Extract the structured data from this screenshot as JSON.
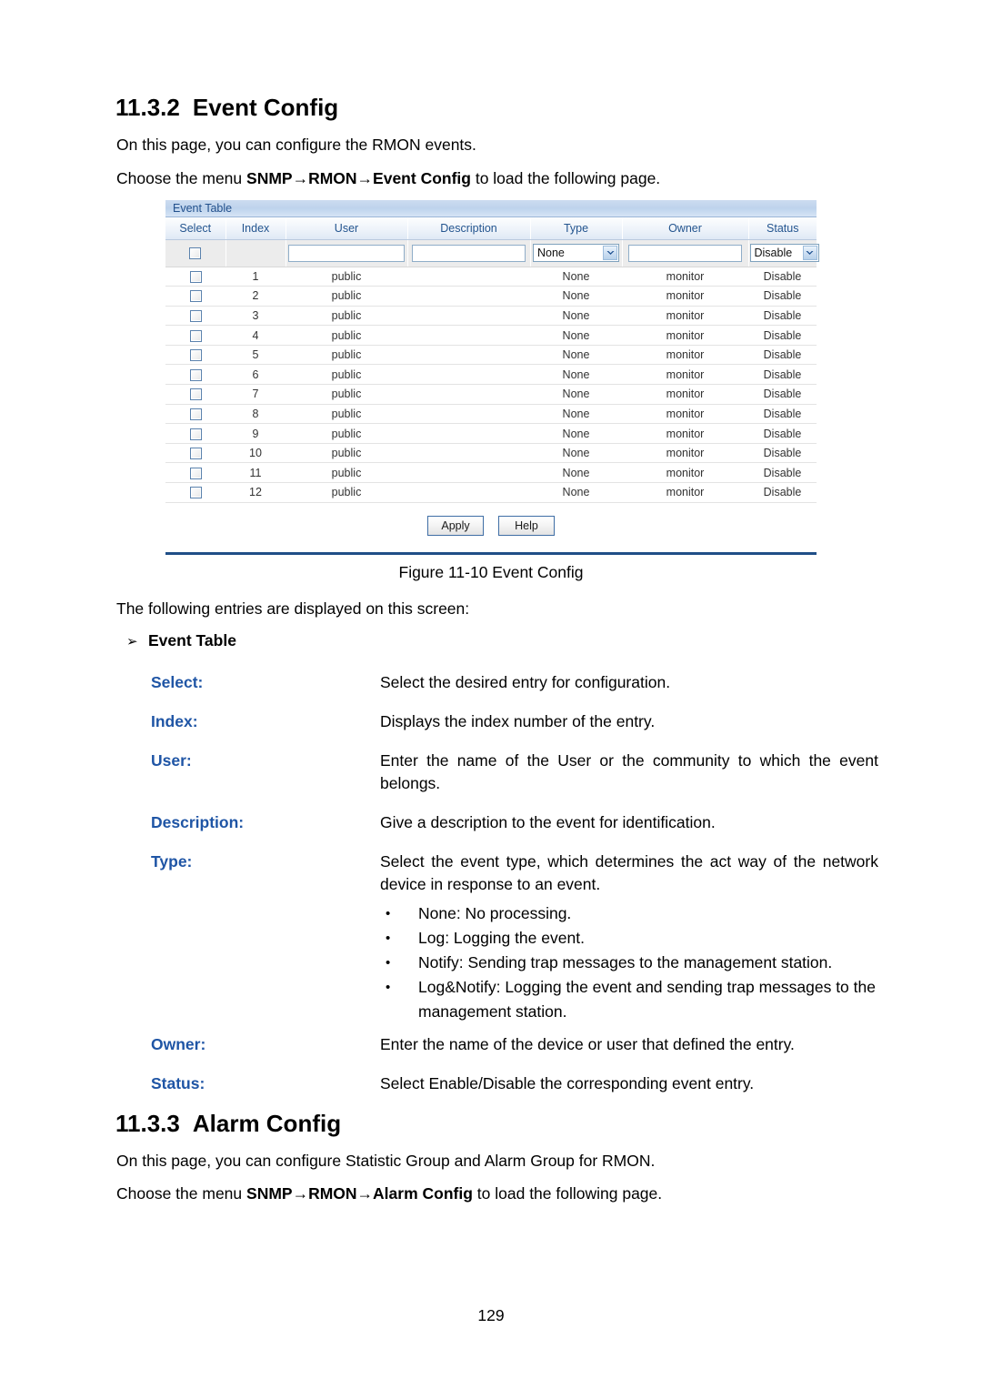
{
  "document": {
    "page_number": "129"
  },
  "section_event": {
    "number": "11.3.2",
    "title": "Event Config",
    "intro": "On this page, you can configure the RMON events.",
    "menu_prefix": "Choose the menu ",
    "menu_path_1": "SNMP",
    "menu_arrow": "→",
    "menu_path_2": "RMON",
    "menu_path_3": "Event Config",
    "menu_suffix": " to load the following page.",
    "figure_caption": "Figure 11-10 Event Config",
    "entries_intro": "The following entries are displayed on this screen:",
    "arrow_glyph": "➢",
    "group_title": "Event Table"
  },
  "event_table": {
    "panel_title": "Event Table",
    "columns": [
      "Select",
      "Index",
      "User",
      "Description",
      "Type",
      "Owner",
      "Status"
    ],
    "edit_row": {
      "user_value": "",
      "description_value": "",
      "type_value": "None",
      "owner_value": "",
      "status_value": "Disable"
    },
    "rows": [
      {
        "index": "1",
        "user": "public",
        "description": "",
        "type": "None",
        "owner": "monitor",
        "status": "Disable"
      },
      {
        "index": "2",
        "user": "public",
        "description": "",
        "type": "None",
        "owner": "monitor",
        "status": "Disable"
      },
      {
        "index": "3",
        "user": "public",
        "description": "",
        "type": "None",
        "owner": "monitor",
        "status": "Disable"
      },
      {
        "index": "4",
        "user": "public",
        "description": "",
        "type": "None",
        "owner": "monitor",
        "status": "Disable"
      },
      {
        "index": "5",
        "user": "public",
        "description": "",
        "type": "None",
        "owner": "monitor",
        "status": "Disable"
      },
      {
        "index": "6",
        "user": "public",
        "description": "",
        "type": "None",
        "owner": "monitor",
        "status": "Disable"
      },
      {
        "index": "7",
        "user": "public",
        "description": "",
        "type": "None",
        "owner": "monitor",
        "status": "Disable"
      },
      {
        "index": "8",
        "user": "public",
        "description": "",
        "type": "None",
        "owner": "monitor",
        "status": "Disable"
      },
      {
        "index": "9",
        "user": "public",
        "description": "",
        "type": "None",
        "owner": "monitor",
        "status": "Disable"
      },
      {
        "index": "10",
        "user": "public",
        "description": "",
        "type": "None",
        "owner": "monitor",
        "status": "Disable"
      },
      {
        "index": "11",
        "user": "public",
        "description": "",
        "type": "None",
        "owner": "monitor",
        "status": "Disable"
      },
      {
        "index": "12",
        "user": "public",
        "description": "",
        "type": "None",
        "owner": "monitor",
        "status": "Disable"
      }
    ],
    "buttons": {
      "apply": "Apply",
      "help": "Help"
    }
  },
  "definitions": [
    {
      "term": "Select:",
      "desc": "Select the desired entry for configuration."
    },
    {
      "term": "Index:",
      "desc": "Displays the index number of the entry."
    },
    {
      "term": "User:",
      "desc": "Enter the name of the User or the community to which the event belongs."
    },
    {
      "term": "Description:",
      "desc": "Give a description to the event for identification."
    },
    {
      "term": "Type:",
      "desc": "Select the event type, which determines the act way of the network device in response to an event.",
      "bullets": [
        "None: No processing.",
        "Log: Logging the event.",
        "Notify: Sending trap messages to the management station.",
        "Log&Notify: Logging the event and sending trap messages to the management station."
      ]
    },
    {
      "term": "Owner:",
      "desc": "Enter the name of the device or user that defined the entry."
    },
    {
      "term": "Status:",
      "desc": "Select Enable/Disable the corresponding event entry."
    }
  ],
  "section_alarm": {
    "number": "11.3.3",
    "title": "Alarm Config",
    "intro": "On this page, you can configure Statistic Group and Alarm Group for RMON.",
    "menu_prefix": "Choose the menu ",
    "menu_path_1": "SNMP",
    "menu_arrow": "→",
    "menu_path_2": "RMON",
    "menu_path_3": "Alarm Config",
    "menu_suffix": " to load the following page."
  },
  "bullet_glyph": "•",
  "colors": {
    "term_blue": "#1f55a5",
    "header_blue": "#24558f",
    "rule_blue": "#1f4e87"
  }
}
